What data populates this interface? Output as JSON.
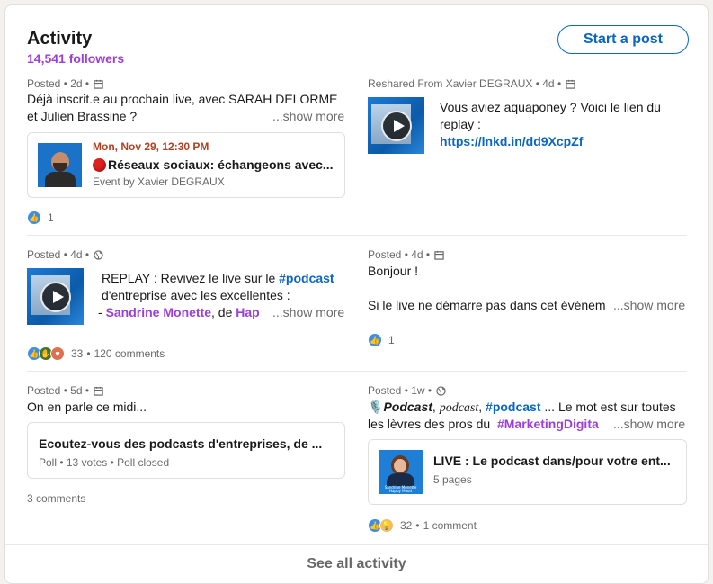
{
  "header": {
    "title": "Activity",
    "followers": "14,541 followers",
    "start_post_label": "Start a post"
  },
  "posts": [
    {
      "meta": "Posted • 2d •",
      "visibility_icon": "calendar-icon",
      "line1": "Déjà inscrit.e au prochain live, avec SARAH DELORME",
      "line2": "et Julien Brassine ?",
      "show_more": "...show more",
      "event": {
        "date": "Mon, Nov 29, 12:30 PM",
        "title": "Réseaux sociaux: échangeons avec...",
        "sub": "Event by Xavier DEGRAUX",
        "live_icon": "red-circle-icon"
      },
      "reactions": [
        "like"
      ],
      "reaction_count": "1"
    },
    {
      "meta": "Reshared From Xavier DEGRAUX • 4d •",
      "visibility_icon": "calendar-icon",
      "line1": "Vous aviez aquaponey ? Voici le lien du",
      "line2": "replay :",
      "link": "https://lnkd.in/dd9XcpZf"
    },
    {
      "meta": "Posted • 4d •",
      "visibility_icon": "globe-icon",
      "line1_prefix": "REPLAY : Revivez le live sur le ",
      "hashtag": "#podcast",
      "line2": "d'entreprise avec les excellentes :",
      "line3_prefix": "- ",
      "mention1": "Sandrine Monette",
      "line3_mid": ", de ",
      "mention2": "Hap",
      "show_more": "...show more",
      "reactions": [
        "like",
        "support",
        "love"
      ],
      "reaction_count": "33",
      "comments": "120 comments"
    },
    {
      "meta": "Posted • 4d •",
      "visibility_icon": "calendar-icon",
      "line1": "Bonjour !",
      "line3": "Si le live ne démarre pas dans cet événem",
      "show_more": "...show more",
      "reactions": [
        "like"
      ],
      "reaction_count": "1"
    },
    {
      "meta": "Posted • 5d •",
      "visibility_icon": "calendar-icon",
      "line1": "On en parle ce midi...",
      "poll": {
        "title": "Ecoutez-vous des podcasts d'entreprises, de ...",
        "sub": "Poll • 13 votes • Poll closed"
      },
      "comments": "3 comments"
    },
    {
      "meta": "Posted • 1w •",
      "visibility_icon": "globe-icon",
      "mic": "🎙️",
      "styled1": "Podcast",
      "sep1": ", ",
      "styled2": "podcast",
      "sep2": ",  ",
      "hashtag": "#podcast",
      "line1_rest": " ... Le mot est sur toutes",
      "line2_prefix": "les lèvres des pros du  ",
      "hashtag2": "#MarketingDigita",
      "show_more": "...show more",
      "doc": {
        "title": "LIVE : Le podcast dans/pour votre ent...",
        "sub": "5 pages",
        "thumb_caption": "Sandrine Monette Happy Mood"
      },
      "reactions": [
        "like",
        "insight"
      ],
      "reaction_count": "32",
      "comments": "1 comment"
    }
  ],
  "footer": {
    "see_all": "See all activity"
  },
  "colors": {
    "brand_blue": "#0a66c2",
    "followers_purple": "#9d3ed8",
    "event_date_red": "#b24020"
  }
}
